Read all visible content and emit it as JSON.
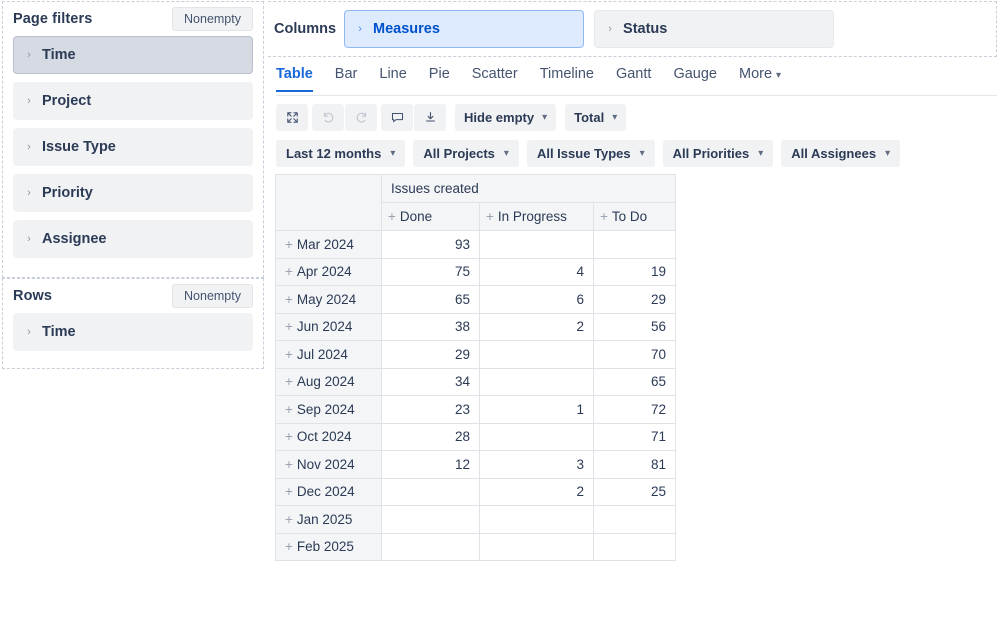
{
  "sidebar": {
    "page_filters": {
      "title": "Page filters",
      "nonempty_label": "Nonempty",
      "items": [
        {
          "label": "Time",
          "selected": true
        },
        {
          "label": "Project",
          "selected": false
        },
        {
          "label": "Issue Type",
          "selected": false
        },
        {
          "label": "Priority",
          "selected": false
        },
        {
          "label": "Assignee",
          "selected": false
        }
      ]
    },
    "rows": {
      "title": "Rows",
      "nonempty_label": "Nonempty",
      "items": [
        {
          "label": "Time",
          "selected": false
        }
      ]
    }
  },
  "columns_zone": {
    "label": "Columns",
    "chips": [
      {
        "label": "Measures",
        "active": true
      },
      {
        "label": "Status",
        "active": false
      }
    ]
  },
  "tabs": [
    {
      "label": "Table",
      "active": true
    },
    {
      "label": "Bar",
      "active": false
    },
    {
      "label": "Line",
      "active": false
    },
    {
      "label": "Pie",
      "active": false
    },
    {
      "label": "Scatter",
      "active": false
    },
    {
      "label": "Timeline",
      "active": false
    },
    {
      "label": "Gantt",
      "active": false
    },
    {
      "label": "Gauge",
      "active": false
    },
    {
      "label": "More",
      "active": false,
      "has_caret": true
    }
  ],
  "toolbar": {
    "fullscreen_icon": "fullscreen-icon",
    "undo_icon": "undo-icon",
    "redo_icon": "redo-icon",
    "comment_icon": "comment-icon",
    "download_icon": "download-icon",
    "hide_empty_label": "Hide empty",
    "total_label": "Total"
  },
  "filters": [
    {
      "label": "Last 12 months"
    },
    {
      "label": "All Projects"
    },
    {
      "label": "All Issue Types"
    },
    {
      "label": "All Priorities"
    },
    {
      "label": "All Assignees"
    }
  ],
  "chart_data": {
    "type": "table",
    "title": "Issues created",
    "group_header": "Issues created",
    "columns": [
      "Done",
      "In Progress",
      "To Do"
    ],
    "row_label": "",
    "categories": [
      "Mar 2024",
      "Apr 2024",
      "May 2024",
      "Jun 2024",
      "Jul 2024",
      "Aug 2024",
      "Sep 2024",
      "Oct 2024",
      "Nov 2024",
      "Dec 2024",
      "Jan 2025",
      "Feb 2025"
    ],
    "series": [
      {
        "name": "Done",
        "values": [
          93,
          75,
          65,
          38,
          29,
          34,
          23,
          28,
          12,
          null,
          null,
          null
        ]
      },
      {
        "name": "In Progress",
        "values": [
          null,
          4,
          6,
          2,
          null,
          null,
          1,
          null,
          3,
          2,
          null,
          null
        ]
      },
      {
        "name": "To Do",
        "values": [
          null,
          19,
          29,
          56,
          70,
          65,
          72,
          71,
          81,
          25,
          null,
          null
        ]
      }
    ],
    "rows": [
      {
        "label": "Mar 2024",
        "cells": [
          "93",
          "",
          ""
        ]
      },
      {
        "label": "Apr 2024",
        "cells": [
          "75",
          "4",
          "19"
        ]
      },
      {
        "label": "May 2024",
        "cells": [
          "65",
          "6",
          "29"
        ]
      },
      {
        "label": "Jun 2024",
        "cells": [
          "38",
          "2",
          "56"
        ]
      },
      {
        "label": "Jul 2024",
        "cells": [
          "29",
          "",
          "70"
        ]
      },
      {
        "label": "Aug 2024",
        "cells": [
          "34",
          "",
          "65"
        ]
      },
      {
        "label": "Sep 2024",
        "cells": [
          "23",
          "1",
          "72"
        ]
      },
      {
        "label": "Oct 2024",
        "cells": [
          "28",
          "",
          "71"
        ]
      },
      {
        "label": "Nov 2024",
        "cells": [
          "12",
          "3",
          "81"
        ]
      },
      {
        "label": "Dec 2024",
        "cells": [
          "",
          "2",
          "25"
        ]
      },
      {
        "label": "Jan 2025",
        "cells": [
          "",
          "",
          ""
        ]
      },
      {
        "label": "Feb 2025",
        "cells": [
          "",
          "",
          ""
        ]
      }
    ]
  },
  "colors": {
    "accent": "#1868db",
    "chip_active_bg": "#deebff",
    "chip_active_text": "#0052cc",
    "text": "#2b3a55",
    "panel_bg": "#f1f2f4"
  }
}
